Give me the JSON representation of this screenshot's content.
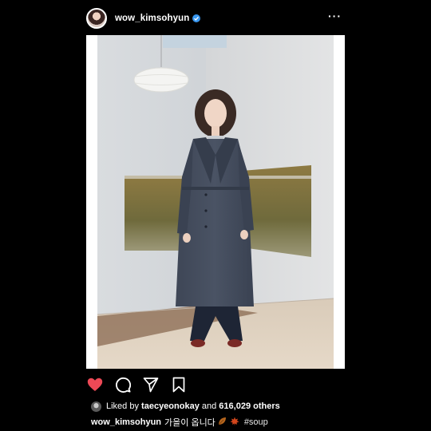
{
  "post": {
    "username": "wow_kimsohyun",
    "verified": true,
    "more_icon": "more-horizontal-icon"
  },
  "actions": {
    "like_icon": "heart-filled-icon",
    "comment_icon": "comment-icon",
    "share_icon": "send-icon",
    "save_icon": "bookmark-icon",
    "like_color": "#ed4956"
  },
  "likes": {
    "prefix": "Liked by",
    "user": "taecyeonokay",
    "middle": "and",
    "count_text": "616,029 others"
  },
  "caption": {
    "username": "wow_kimsohyun",
    "text": "가을이 옵니다",
    "emoji": [
      "leaf-icon",
      "maple-leaf-icon"
    ],
    "hashtag": "#soup"
  }
}
